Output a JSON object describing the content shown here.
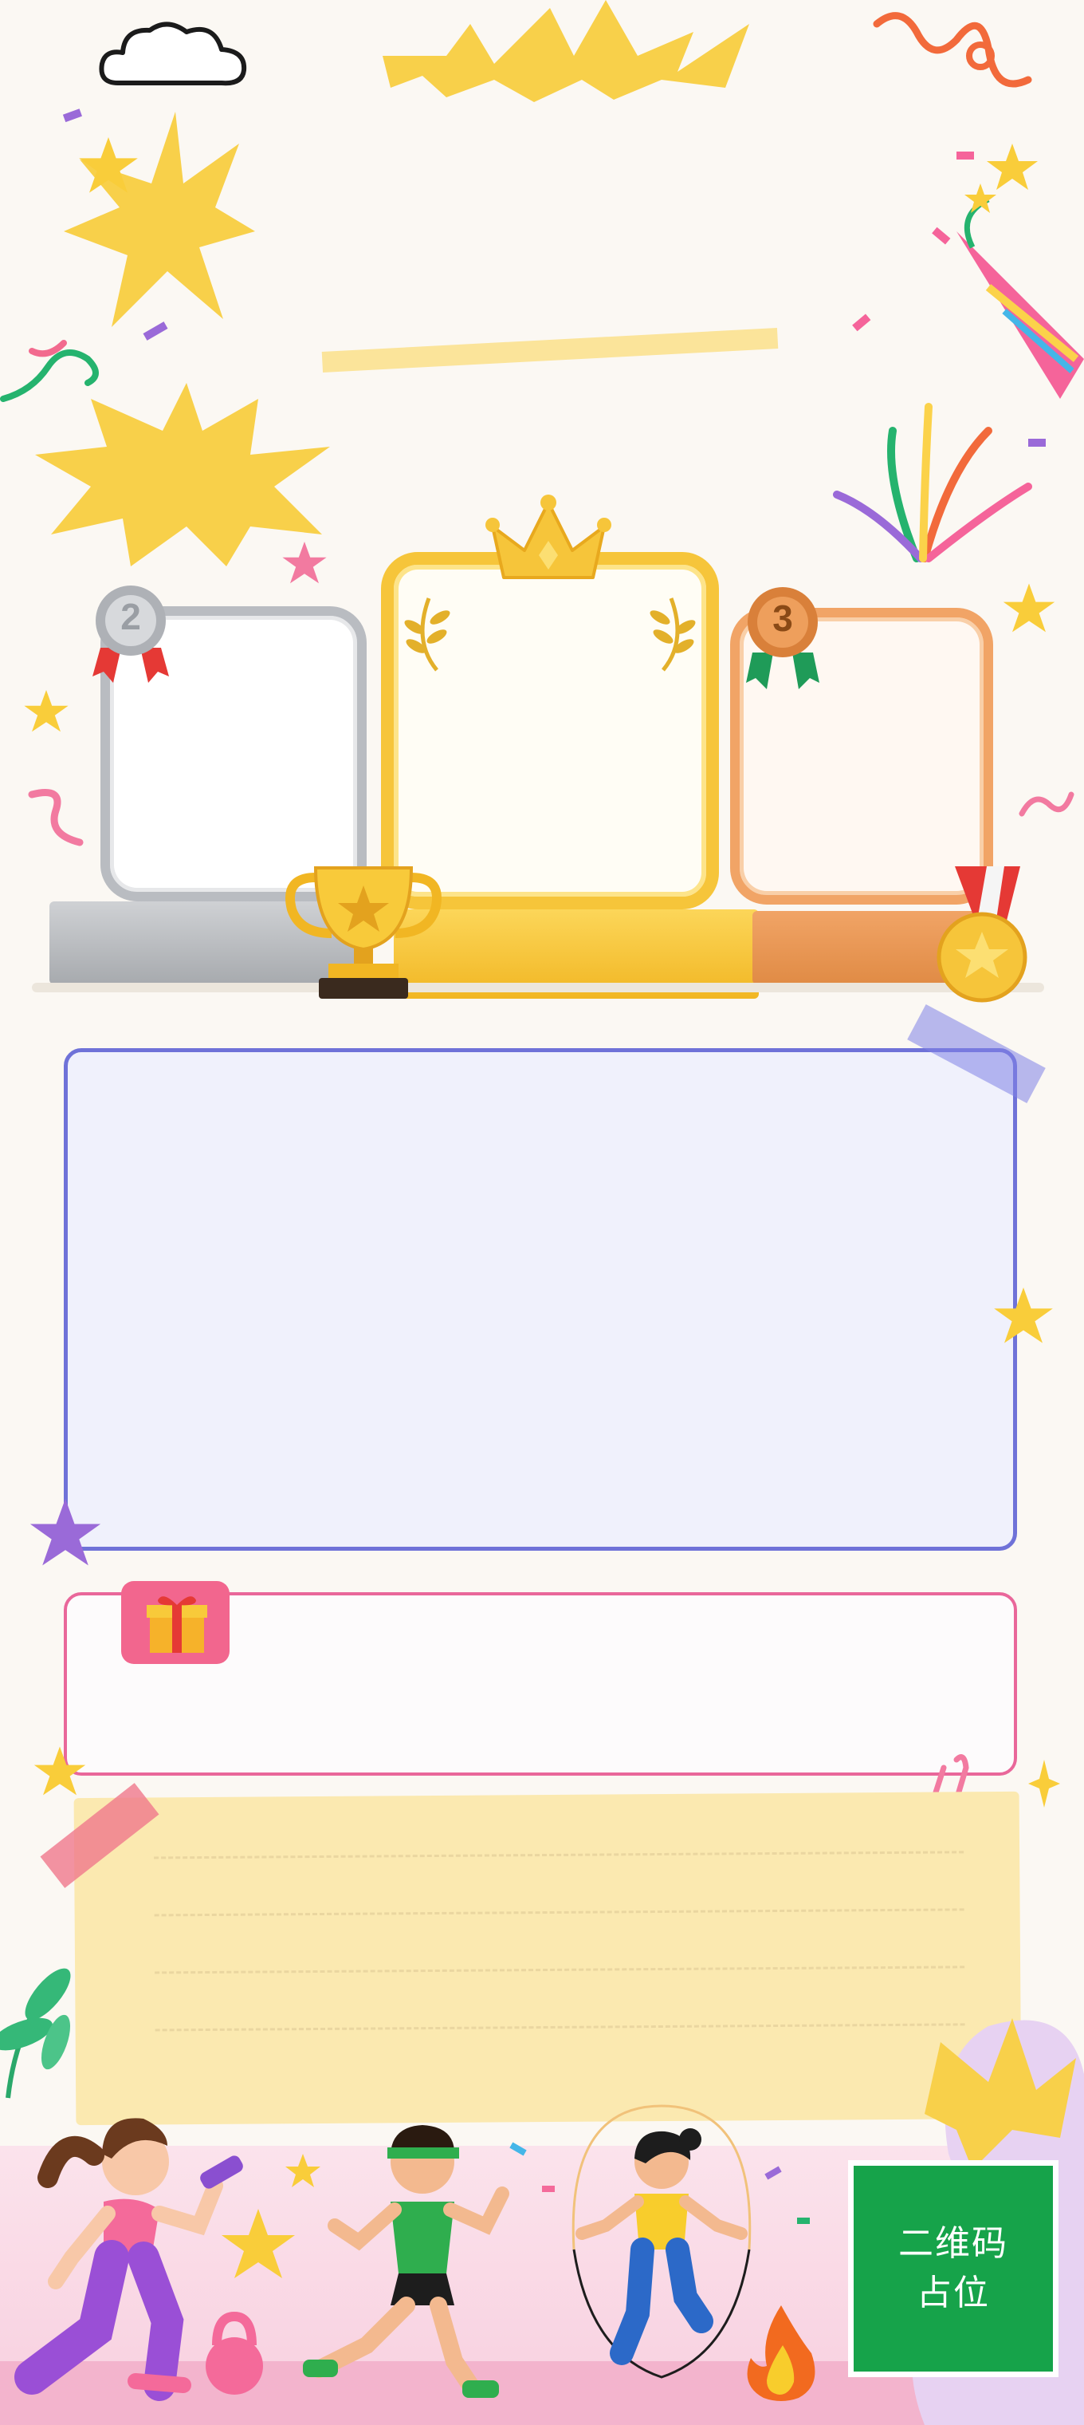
{
  "qr_placeholder": {
    "label": "二维码\n占位",
    "background": "#16a34a"
  },
  "medals": {
    "second": "2",
    "third": "3"
  },
  "icons": [
    "cloud-icon",
    "crown-icon",
    "trophy-icon",
    "medal-icon",
    "party-popper-icon",
    "gift-icon",
    "star-icon",
    "paperclip-icon",
    "flame-icon",
    "kettlebell-icon",
    "dumbbell-icon",
    "leaf-icon"
  ],
  "colors": {
    "background": "#fbf8f3",
    "gold": "#f6c53a",
    "silver": "#b9bcc1",
    "bronze": "#f1a466",
    "purple_panel": "#6f72d8",
    "pink_panel": "#e9679a",
    "note": "#fbe9b0",
    "qr": "#16a34a"
  }
}
